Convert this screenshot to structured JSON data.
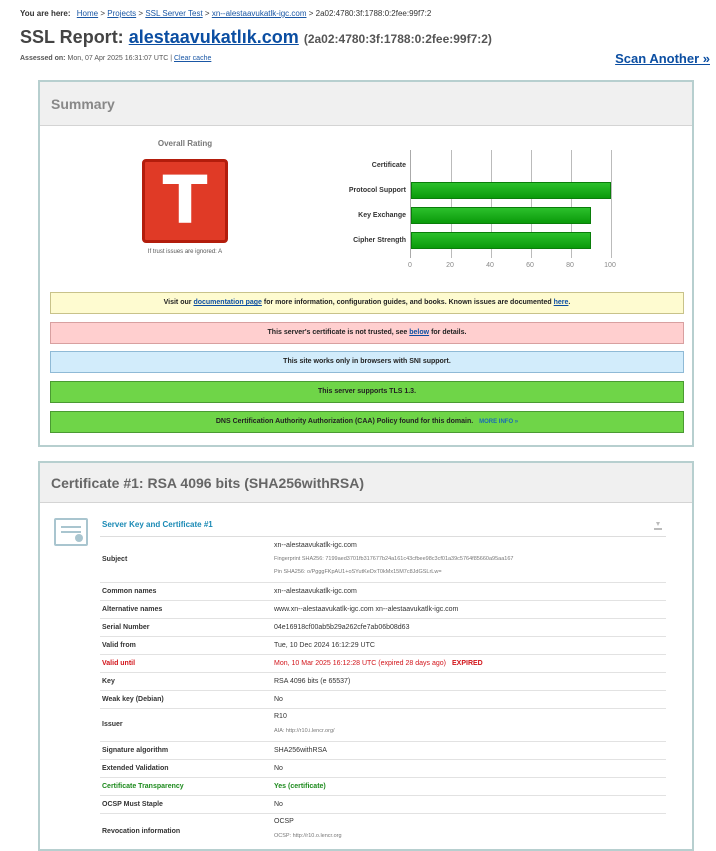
{
  "breadcrumb": {
    "prefix": "You are here:",
    "home": "Home",
    "projects": "Projects",
    "ssl_test": "SSL Server Test",
    "host": "xn--alestaavukatlk-igc.com",
    "ip": "> 2a02:4780:3f:1788:0:2fee:99f7:2",
    "sep": ">"
  },
  "header": {
    "title_prefix": "SSL Report:",
    "host": "alestaavukatlık.com",
    "ip": "(2a02:4780:3f:1788:0:2fee:99f7:2)",
    "assessed_label": "Assessed on:",
    "assessed_value": "Mon, 07 Apr 2025 16:31:07 UTC |",
    "clear_cache": "Clear cache",
    "scan_another": "Scan Another »"
  },
  "summary": {
    "heading": "Summary",
    "overall_rating_label": "Overall Rating",
    "grade": "T",
    "if_trust_ignored": "If trust issues are ignored: A",
    "notices": {
      "doc_pre": "Visit our",
      "doc_link": "documentation page",
      "doc_mid": "for more information, configuration guides, and books. Known issues are documented",
      "doc_here": "here",
      "doc_end": ".",
      "cert_pre": "This server's certificate is not trusted, see",
      "cert_link": "below",
      "cert_end": "for details.",
      "sni": "This site works only in browsers with SNI support.",
      "tls13": "This server supports TLS 1.3.",
      "caa": "DNS Certification Authority Authorization (CAA) Policy found for this domain.",
      "caa_more": "MORE INFO »"
    }
  },
  "chart_data": {
    "type": "bar",
    "orientation": "horizontal",
    "categories": [
      "Certificate",
      "Protocol Support",
      "Key Exchange",
      "Cipher Strength"
    ],
    "values": [
      0,
      100,
      90,
      90
    ],
    "xlim": [
      0,
      100
    ],
    "ticks": [
      0,
      20,
      40,
      60,
      80,
      100
    ],
    "bar_color": "#13a813",
    "grid": true
  },
  "cert": {
    "heading": "Certificate #1: RSA 4096 bits (SHA256withRSA)",
    "section_title": "Server Key and Certificate #1",
    "rows": {
      "subject": {
        "k": "Subject",
        "v": "xn--alestaavukatlk-igc.com",
        "fp": "Fingerprint SHA256: 7199aed3701fb317677b24a161c43cfbee98c3cf01a39c5764f85660a95aa167",
        "pin": "Pin SHA256: o/PgggFKpAU1+oSYutKeDxT0kMx15M7c8JdGSLrLw="
      },
      "common_names": {
        "k": "Common names",
        "v": "xn--alestaavukatlk-igc.com"
      },
      "alt_names": {
        "k": "Alternative names",
        "v": "www.xn--alestaavukatlk-igc.com xn--alestaavukatlk-igc.com"
      },
      "serial": {
        "k": "Serial Number",
        "v": "04e16918cf00ab5b29a262cfe7ab06b08d63"
      },
      "valid_from": {
        "k": "Valid from",
        "v": "Tue, 10 Dec 2024 16:12:29 UTC"
      },
      "valid_until": {
        "k": "Valid until",
        "v": "Mon, 10 Mar 2025 16:12:28 UTC (expired 28 days ago)",
        "badge": "EXPIRED"
      },
      "key": {
        "k": "Key",
        "v": "RSA 4096 bits (e 65537)"
      },
      "weak_key": {
        "k": "Weak key (Debian)",
        "v": "No"
      },
      "issuer": {
        "k": "Issuer",
        "v": "R10",
        "aia": "AIA: http://r10.i.lencr.org/"
      },
      "sig_alg": {
        "k": "Signature algorithm",
        "v": "SHA256withRSA"
      },
      "ev": {
        "k": "Extended Validation",
        "v": "No"
      },
      "ct": {
        "k": "Certificate Transparency",
        "v": "Yes (certificate)"
      },
      "ocsp_staple": {
        "k": "OCSP Must Staple",
        "v": "No"
      },
      "revocation": {
        "k": "Revocation information",
        "v": "OCSP",
        "sub": "OCSP: http://r10.o.lencr.org"
      }
    }
  }
}
